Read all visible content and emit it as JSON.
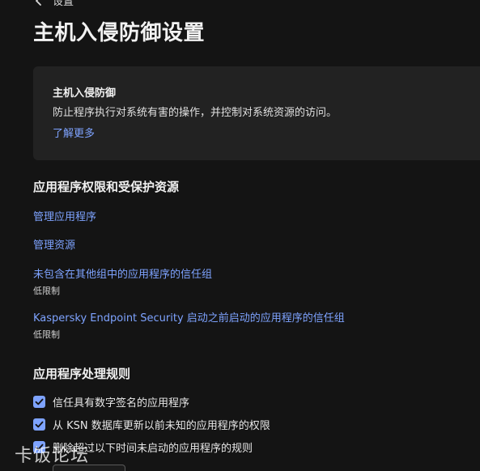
{
  "header": {
    "back_label": "设置",
    "title": "主机入侵防御设置"
  },
  "info_card": {
    "title": "主机入侵防御",
    "description": "防止程序执行对系统有害的操作，并控制对系统资源的访问。",
    "learn_more": "了解更多"
  },
  "permissions_section": {
    "title": "应用程序权限和受保护资源",
    "manage_apps": "管理应用程序",
    "manage_resources": "管理资源",
    "trust_group_other": {
      "label": "未包含在其他组中的应用程序的信任组",
      "value": "低限制"
    },
    "trust_group_before_start": {
      "label": "Kaspersky Endpoint Security 启动之前启动的应用程序的信任组",
      "value": "低限制"
    }
  },
  "rules_section": {
    "title": "应用程序处理规则",
    "options": [
      {
        "label": "信任具有数字签名的应用程序",
        "checked": true
      },
      {
        "label": "从 KSN 数据库更新以前未知的应用程序的权限",
        "checked": true
      },
      {
        "label": "删除超过以下时间未启动的应用程序的规则",
        "checked": true
      }
    ]
  },
  "watermark": "卡饭论坛",
  "colors": {
    "background": "#141414",
    "card": "#222222",
    "accent": "#7ea3ff",
    "text": "#e8e8e8"
  },
  "icons": {
    "back": "chevron-left-icon",
    "check": "checkmark-icon"
  }
}
